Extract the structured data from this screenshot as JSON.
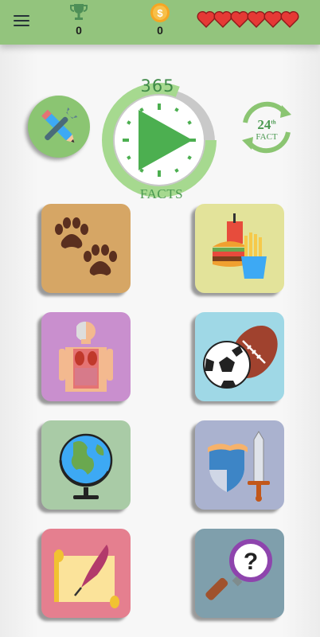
{
  "header": {
    "trophy_count": "0",
    "coin_count": "0",
    "lives": 6,
    "colors": {
      "bar": "#93c47d",
      "heart": "#e53935"
    }
  },
  "center": {
    "label_top": "365",
    "label_bottom": "FACTS"
  },
  "daily": {
    "day": "24",
    "suffix": "th",
    "label": "FACT"
  },
  "categories": [
    {
      "id": "animals",
      "icon": "paw-icon",
      "color": "#d6a665"
    },
    {
      "id": "food",
      "icon": "fast-food-icon",
      "color": "#e3e39a"
    },
    {
      "id": "human-body",
      "icon": "anatomy-icon",
      "color": "#c98fce"
    },
    {
      "id": "sports",
      "icon": "balls-icon",
      "color": "#9fd8e6"
    },
    {
      "id": "geography",
      "icon": "globe-icon",
      "color": "#a9cba6"
    },
    {
      "id": "history",
      "icon": "shield-sword-icon",
      "color": "#aab2cf"
    },
    {
      "id": "literature",
      "icon": "scroll-quill-icon",
      "color": "#e57f8f"
    },
    {
      "id": "mystery",
      "icon": "magnifier-question-icon",
      "color": "#7f9fac"
    }
  ]
}
